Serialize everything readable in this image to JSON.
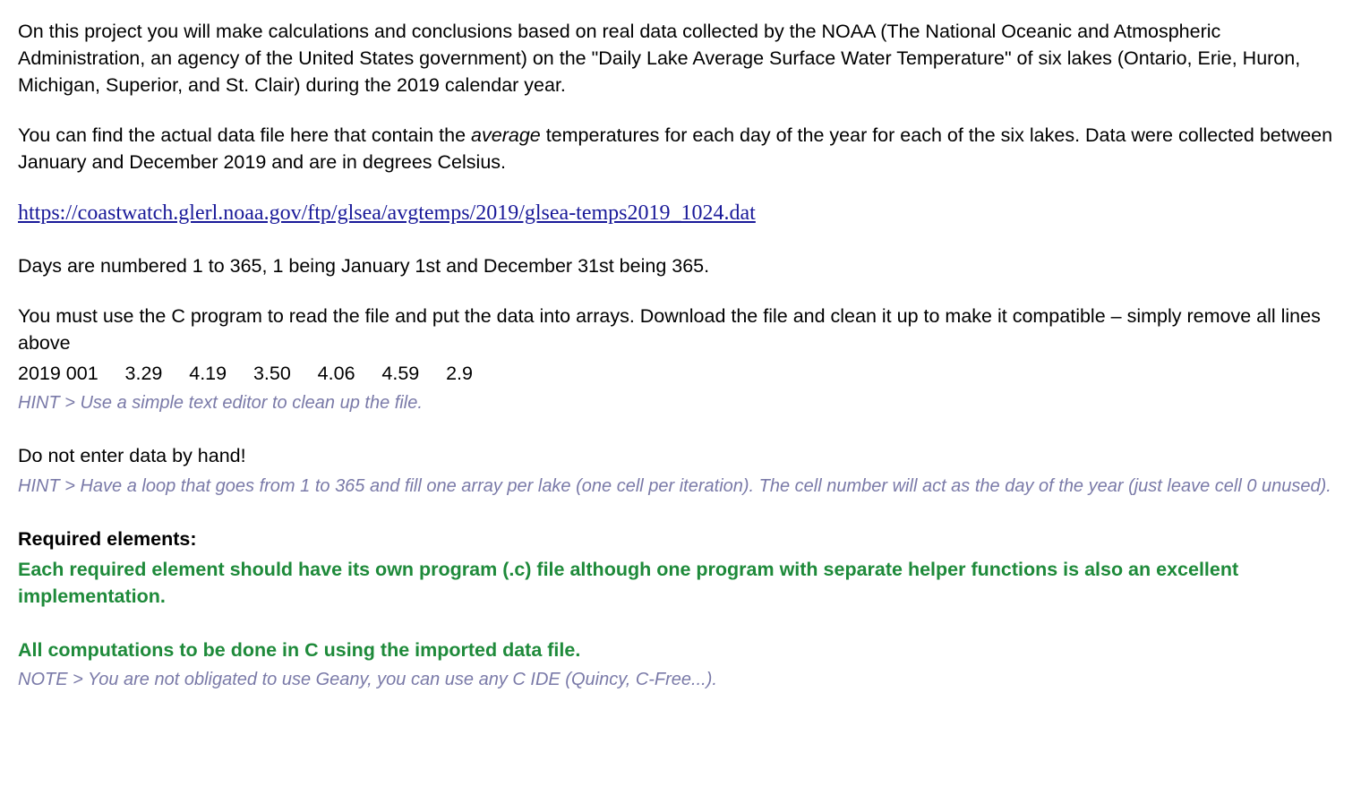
{
  "para1_a": "On this project you will make calculations and conclusions based on real data collected by the NOAA (The National Oceanic and Atmospheric Administration, an agency of the United States government) on the \"Daily Lake Average Surface Water Temperature\" of six lakes (Ontario, Erie, Huron, Michigan, Superior, and St. Clair) during the 2019 calendar year.",
  "para2_pre": "You can find the actual data file here that contain the ",
  "para2_em": "average",
  "para2_post": " temperatures for each day of the year for each of the six lakes. Data were collected between January and December 2019 and are in degrees Celsius.",
  "link_url": "https://coastwatch.glerl.noaa.gov/ftp/glsea/avgtemps/2019/glsea-temps2019_1024.dat",
  "para3": "Days are numbered 1 to 365, 1 being January 1st and December 31st being 365.",
  "para4_a": "You must use the C program to read the file and put the data into arrays. Download the file and clean it up to make it compatible – simply remove all lines above",
  "data_line": "2019 001     3.29     4.19     3.50     4.06     4.59     2.9",
  "hint1": "HINT > Use a simple text editor to clean up the file.",
  "para5": "Do not enter data by hand!",
  "hint2": "HINT > Have a loop that goes from 1 to 365 and fill one array per lake (one cell per iteration). The cell number will act as the day of the year (just leave cell 0 unused).",
  "req_header": "Required elements:",
  "req_text": "Each required element should have its own program (.c) file although one program with separate helper functions is also an excellent implementation.",
  "comp_text": "All computations to be done in C using the imported data file.",
  "note_text": "NOTE > You are not obligated to use Geany, you can use any C IDE (Quincy, C-Free...)."
}
